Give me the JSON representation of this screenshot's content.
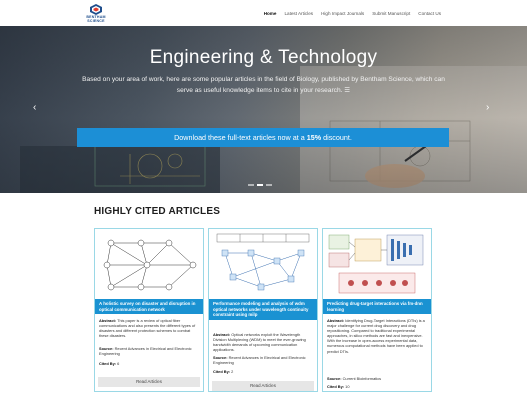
{
  "header": {
    "logo_text": "BENTHAM SCIENCE",
    "nav": [
      {
        "label": "Home",
        "active": true
      },
      {
        "label": "Latest Articles",
        "active": false
      },
      {
        "label": "High Impact Journals",
        "active": false
      },
      {
        "label": "Submit Manuscript",
        "active": false
      },
      {
        "label": "Contact Us",
        "active": false
      }
    ]
  },
  "hero": {
    "title": "Engineering & Technology",
    "subtitle": "Based on your area of work, here are some popular articles in the field of Biology, published by Bentham Science, which can serve as useful knowledge items to cite in your research. ☰",
    "cta_prefix": "Download these full-text articles now at a ",
    "cta_discount": "15%",
    "cta_suffix": " discount.",
    "prev_icon": "‹",
    "next_icon": "›",
    "slides": 3,
    "active_slide": 1
  },
  "section": {
    "title": "HIGHLY CITED ARTICLES"
  },
  "labels": {
    "abstract": "Abstract:",
    "source": "Source:",
    "cited": "Cited By:",
    "read": "Read Articles"
  },
  "cards": [
    {
      "title": "A holistic survey on disaster and disruption in optical communication network",
      "abstract": "This paper is a review of optical fiber communications and also presents the different types of disasters and different protection schemes to combat these disasters.",
      "source": "Recent Advances in Electrical and Electronic Engineering",
      "cited": "6",
      "image": "network-graph-diagram"
    },
    {
      "title": "Performance modeling and analysis of wdm optical networks under wavelength continuity constraint using milp",
      "abstract": "Optical networks exploit the Wavelength Division Multiplexing (WDM) to meet the ever-growing bandwidth demands of upcoming communication applications.",
      "source": "Recent Advances in Electrical and Electronic Engineering",
      "cited": "2",
      "image": "wdm-network-diagram"
    },
    {
      "title": "Predicting drug-target interactions via fm-dnn learning",
      "abstract": "Identifying Drug-Target Interactions (DTIs) is a major challenge for current drug discovery and drug repositioning. Compared to traditional experimental approaches, in silico methods are fast and inexpensive. With the increase in open-access experimental data, numerous computational methods have been applied to predict DTIs.",
      "source": "Current Bioinformatics",
      "cited": "10",
      "image": "fm-dnn-pipeline-diagram"
    }
  ]
}
